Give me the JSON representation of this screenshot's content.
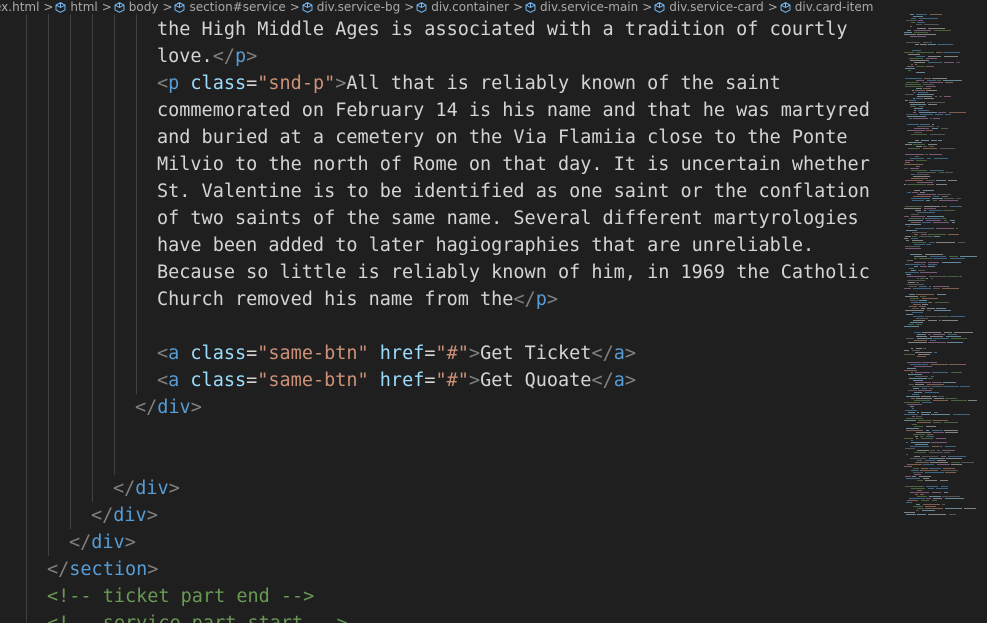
{
  "breadcrumb": {
    "items": [
      {
        "label": "ex.html",
        "icon": "html-file-icon"
      },
      {
        "label": "html",
        "icon": "cube-icon"
      },
      {
        "label": "body",
        "icon": "cube-icon"
      },
      {
        "label": "section#service",
        "icon": "cube-icon"
      },
      {
        "label": "div.service-bg",
        "icon": "cube-icon"
      },
      {
        "label": "div.container",
        "icon": "cube-icon"
      },
      {
        "label": "div.service-main",
        "icon": "cube-icon"
      },
      {
        "label": "div.service-card",
        "icon": "cube-icon"
      },
      {
        "label": "div.card-item",
        "icon": "cube-icon"
      }
    ],
    "separator": ">"
  },
  "code": {
    "lines": [
      {
        "tokens": [
          {
            "t": "text",
            "v": "the High Middle Ages is associated with a tradition of courtly"
          }
        ]
      },
      {
        "tokens": [
          {
            "t": "text",
            "v": "love."
          },
          {
            "t": "punct",
            "v": "</"
          },
          {
            "t": "tag",
            "v": "p"
          },
          {
            "t": "punct",
            "v": ">"
          }
        ]
      },
      {
        "tokens": [
          {
            "t": "punct",
            "v": "<"
          },
          {
            "t": "tag",
            "v": "p"
          },
          {
            "t": "text",
            "v": " "
          },
          {
            "t": "attr",
            "v": "class"
          },
          {
            "t": "text",
            "v": "="
          },
          {
            "t": "str",
            "v": "\"snd-p\""
          },
          {
            "t": "punct",
            "v": ">"
          },
          {
            "t": "text",
            "v": "All that is reliably known of the saint"
          }
        ]
      },
      {
        "tokens": [
          {
            "t": "text",
            "v": "commemorated on February 14 is his name and that he was martyred"
          }
        ]
      },
      {
        "tokens": [
          {
            "t": "text",
            "v": "and buried at a cemetery on the Via Flamiia close to the Ponte"
          }
        ]
      },
      {
        "tokens": [
          {
            "t": "text",
            "v": "Milvio to the north of Rome on that day. It is uncertain whether"
          }
        ]
      },
      {
        "tokens": [
          {
            "t": "text",
            "v": "St. Valentine is to be identified as one saint or the conflation"
          }
        ]
      },
      {
        "tokens": [
          {
            "t": "text",
            "v": "of two saints of the same name. Several different martyrologies"
          }
        ]
      },
      {
        "tokens": [
          {
            "t": "text",
            "v": "have been added to later hagiographies that are unreliable."
          }
        ]
      },
      {
        "tokens": [
          {
            "t": "text",
            "v": "Because so little is reliably known of him, in 1969 the Catholic"
          }
        ]
      },
      {
        "tokens": [
          {
            "t": "text",
            "v": "Church removed his name from the"
          },
          {
            "t": "punct",
            "v": "</"
          },
          {
            "t": "tag",
            "v": "p"
          },
          {
            "t": "punct",
            "v": ">"
          }
        ]
      },
      {
        "tokens": []
      },
      {
        "tokens": [
          {
            "t": "punct",
            "v": "<"
          },
          {
            "t": "tag",
            "v": "a"
          },
          {
            "t": "text",
            "v": " "
          },
          {
            "t": "attr",
            "v": "class"
          },
          {
            "t": "text",
            "v": "="
          },
          {
            "t": "str",
            "v": "\"same-btn\""
          },
          {
            "t": "text",
            "v": " "
          },
          {
            "t": "attr",
            "v": "href"
          },
          {
            "t": "text",
            "v": "="
          },
          {
            "t": "str",
            "v": "\"#\""
          },
          {
            "t": "punct",
            "v": ">"
          },
          {
            "t": "text",
            "v": "Get Ticket"
          },
          {
            "t": "punct",
            "v": "</"
          },
          {
            "t": "tag",
            "v": "a"
          },
          {
            "t": "punct",
            "v": ">"
          }
        ]
      },
      {
        "tokens": [
          {
            "t": "punct",
            "v": "<"
          },
          {
            "t": "tag",
            "v": "a"
          },
          {
            "t": "text",
            "v": " "
          },
          {
            "t": "attr",
            "v": "class"
          },
          {
            "t": "text",
            "v": "="
          },
          {
            "t": "str",
            "v": "\"same-btn\""
          },
          {
            "t": "text",
            "v": " "
          },
          {
            "t": "attr",
            "v": "href"
          },
          {
            "t": "text",
            "v": "="
          },
          {
            "t": "str",
            "v": "\"#\""
          },
          {
            "t": "punct",
            "v": ">"
          },
          {
            "t": "text",
            "v": "Get Quoate"
          },
          {
            "t": "punct",
            "v": "</"
          },
          {
            "t": "tag",
            "v": "a"
          },
          {
            "t": "punct",
            "v": ">"
          }
        ]
      },
      {
        "tokens": [
          {
            "t": "punct",
            "v": "</"
          },
          {
            "t": "tag",
            "v": "div"
          },
          {
            "t": "punct",
            "v": ">"
          }
        ]
      },
      {
        "tokens": []
      },
      {
        "tokens": []
      },
      {
        "tokens": [
          {
            "t": "punct",
            "v": "</"
          },
          {
            "t": "tag",
            "v": "div"
          },
          {
            "t": "punct",
            "v": ">"
          }
        ]
      },
      {
        "tokens": [
          {
            "t": "punct",
            "v": "</"
          },
          {
            "t": "tag",
            "v": "div"
          },
          {
            "t": "punct",
            "v": ">"
          }
        ]
      },
      {
        "tokens": [
          {
            "t": "punct",
            "v": "</"
          },
          {
            "t": "tag",
            "v": "div"
          },
          {
            "t": "punct",
            "v": ">"
          }
        ]
      },
      {
        "tokens": [
          {
            "t": "punct",
            "v": "</"
          },
          {
            "t": "tag",
            "v": "section"
          },
          {
            "t": "punct",
            "v": ">"
          }
        ]
      },
      {
        "tokens": [
          {
            "t": "comment",
            "v": "<!-- ticket part end -->"
          }
        ]
      },
      {
        "tokens": [
          {
            "t": "comment",
            "v": "<!-- service part start -->"
          }
        ]
      }
    ]
  },
  "colors": {
    "background": "#1f1f1f",
    "tag": "#569cd6",
    "punctuation": "#808080",
    "attribute": "#9cdcfe",
    "string": "#ce9178",
    "text": "#d4d4d4",
    "comment": "#6a9955"
  }
}
